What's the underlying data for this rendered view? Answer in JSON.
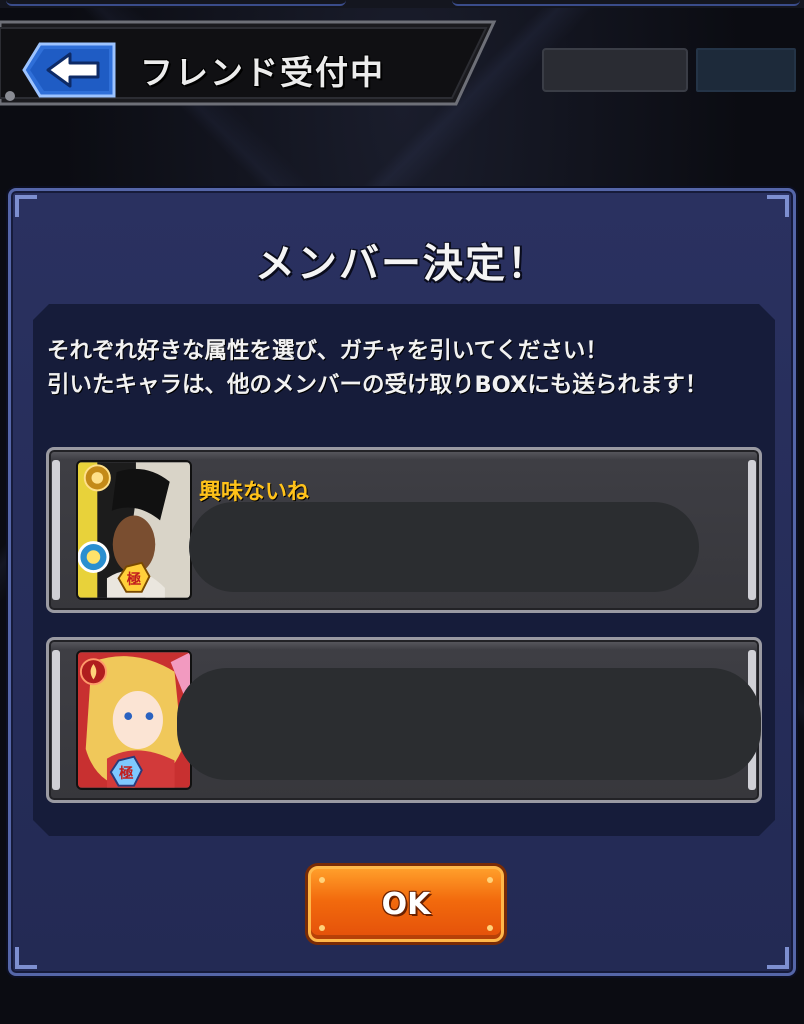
{
  "header": {
    "title": "フレンド受付中",
    "back_icon": "back-arrow-icon"
  },
  "modal": {
    "title": "メンバー決定！",
    "description_line1": "それぞれ好きな属性を選び、ガチャを引いてください！",
    "description_line2": "引いたキャラは、他のメンバーの受け取りBOXにも送られます！",
    "members": [
      {
        "name": "興味ないね",
        "badge": "極"
      },
      {
        "name": "",
        "badge": "極"
      }
    ],
    "ok_label": "OK"
  },
  "colors": {
    "modal_bg": "#2a3160",
    "name_color": "#ffc21a",
    "ok_button": "#f26a0d",
    "back_button": "#2f6fd8"
  }
}
